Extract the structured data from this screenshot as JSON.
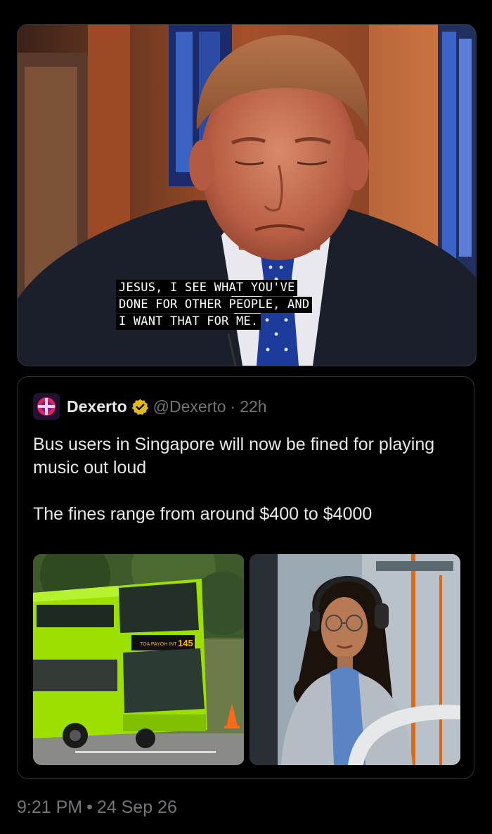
{
  "meme": {
    "caption_lines": [
      "JESUS, I SEE WHAT YOU'VE",
      "DONE FOR OTHER PEOPLE, AND",
      "I WANT THAT FOR ME."
    ]
  },
  "quote": {
    "author": {
      "display_name": "Dexerto",
      "handle": "@Dexerto",
      "time_ago": "22h",
      "verified_icon": "verified-gold-badge-icon"
    },
    "separator": "·",
    "text": [
      "Bus users in Singapore will now be fined for playing music out loud",
      "The fines range from around $400 to $4000"
    ],
    "media": {
      "bus_sign_text": "TOA PAYOH INT",
      "bus_route_number": "145"
    }
  },
  "footer": {
    "time": "9:21 PM",
    "separator": "•",
    "date": "24 Sep 26"
  },
  "colors": {
    "background": "#000000",
    "text_primary": "#e7e9ea",
    "text_secondary": "#71767b",
    "border": "#2f3336",
    "verified_gold": "#e2b719"
  }
}
